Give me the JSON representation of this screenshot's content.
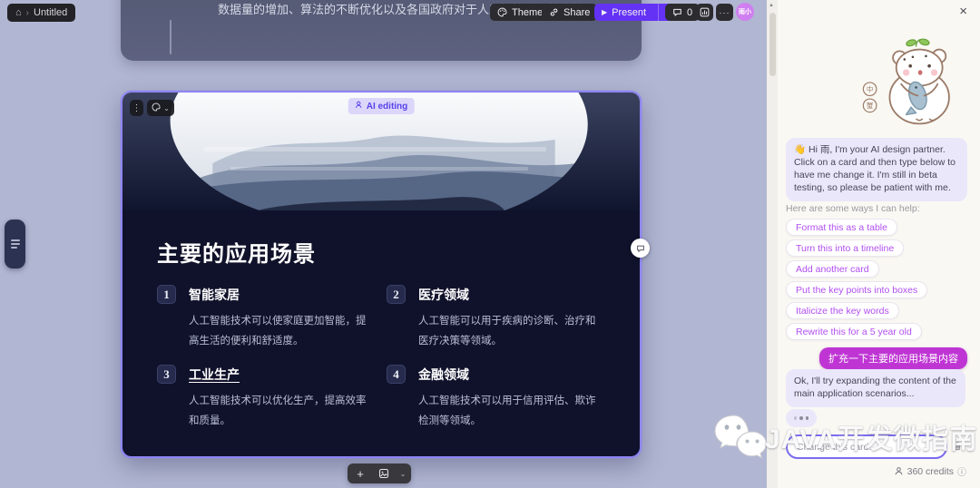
{
  "topbar": {
    "breadcrumb_title": "Untitled",
    "theme_label": "Theme",
    "share_label": "Share",
    "present_label": "Present",
    "comment_count": "0",
    "avatar_initials": "雨小"
  },
  "icons": {
    "home": "⌂",
    "chevron_right": "›",
    "play": "▶",
    "chevron_down": "⌄",
    "ellipsis": "···",
    "drag_dots": "⋮",
    "plus": "+",
    "close": "×",
    "up_arrow": "▲",
    "info": "ⓘ",
    "typing_dots": "···"
  },
  "canvas": {
    "previous_card_text": "数据量的增加、算法的不断优化以及各国政府对于人工智能产业的支持",
    "ai_editing_badge": "AI editing",
    "slide": {
      "title": "主要的应用场景",
      "items": [
        {
          "num": "1",
          "title": "智能家居",
          "body": "人工智能技术可以使家庭更加智能，提高生活的便利和舒适度。"
        },
        {
          "num": "2",
          "title": "医疗领域",
          "body": "人工智能可以用于疾病的诊断、治疗和医疗决策等领域。"
        },
        {
          "num": "3",
          "title": "工业生产",
          "body": "人工智能技术可以优化生产，提高效率和质量。"
        },
        {
          "num": "4",
          "title": "金融领域",
          "body": "人工智能技术可以用于信用评估、欺诈检测等领域。"
        }
      ]
    }
  },
  "sidebar": {
    "greeting": "👋 Hi 雨, I'm your AI design partner. Click on a card and then type below to have me change it. I'm still in beta testing, so please be patient with me.",
    "help_intro": "Here are some ways I can help:",
    "suggestions": [
      "Format this as a table",
      "Turn this into a timeline",
      "Add another card",
      "Put the key points into boxes",
      "Italicize the key words",
      "Rewrite this for a 5 year old"
    ],
    "user_message": "扩充一下主要的应用场景内容",
    "ai_reply": "Ok, I'll try expanding the content of the main application scenarios...",
    "input_placeholder": "Change this card...",
    "credits_label": "360 credits"
  },
  "watermark_text": "JAVA开发微指南",
  "colors": {
    "canvas_bg": "#b1b7d2",
    "slide_bg": "#10122b",
    "card_border": "#8e84f3",
    "accent_purple": "#6432f5",
    "ai_bubble": "#eae7fa",
    "user_bubble": "#bf35d4",
    "chip_text": "#b14ef0",
    "sidebar_bg": "#faf8f3",
    "badge_bg": "#dcd6fb",
    "badge_text": "#5743ea"
  }
}
